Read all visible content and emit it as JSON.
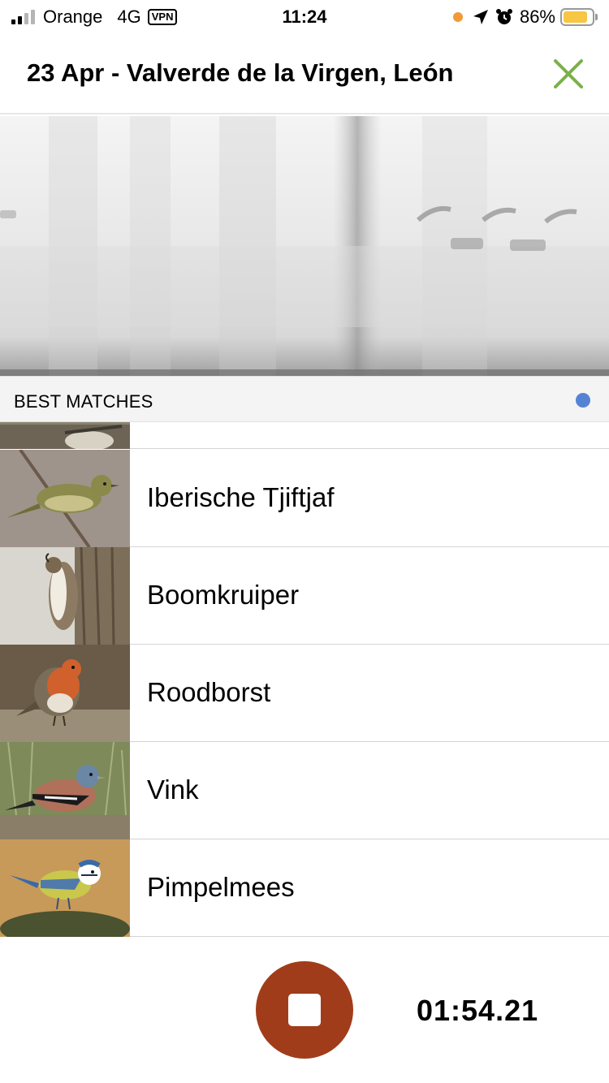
{
  "status_bar": {
    "carrier": "Orange",
    "network": "4G",
    "vpn": "VPN",
    "time": "11:24",
    "battery": "86%",
    "battery_level": 0.86,
    "signal_bars": 2,
    "icons": [
      "orange-dot-icon",
      "location-arrow-icon",
      "alarm-icon",
      "battery-icon"
    ]
  },
  "header": {
    "title": "23 Apr - Valverde de la Virgen, León",
    "close_icon": "close-icon",
    "close_color": "#7ab04a"
  },
  "section": {
    "title": "BEST MATCHES",
    "indicator_color": "#5583d4"
  },
  "matches": [
    {
      "name": "Iberische Tjiftjaf"
    },
    {
      "name": "Boomkruiper"
    },
    {
      "name": "Roodborst"
    },
    {
      "name": "Vink"
    },
    {
      "name": "Pimpelmees"
    }
  ],
  "recorder": {
    "stop_icon": "stop-icon",
    "button_color": "#a13c1a",
    "elapsed": "01:54.21"
  }
}
